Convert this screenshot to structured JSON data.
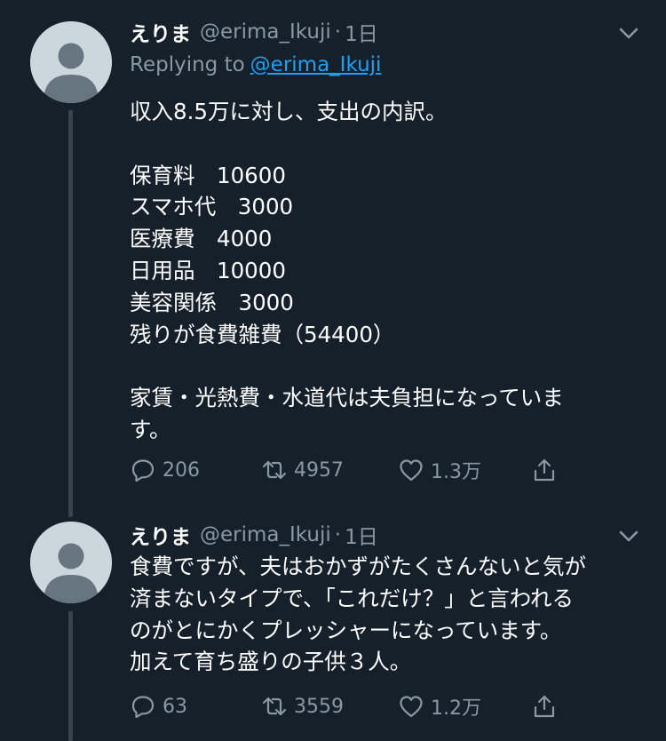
{
  "tweets": [
    {
      "display_name": "えりま",
      "handle": "@erima_Ikuji",
      "dot": "·",
      "time": "1日",
      "replying_label": "Replying to",
      "replying_mention": "@erima_Ikuji",
      "lines": [
        "収入8.5万に対し、支出の内訳。",
        "",
        "保育料　10600",
        "スマホ代　3000",
        "医療費　4000",
        "日用品　10000",
        "美容関係　3000",
        "残りが食費雑費（54400）",
        "",
        "家賃・光熱費・水道代は夫負担になっていま",
        "す。"
      ],
      "reply_count": "206",
      "retweet_count": "4957",
      "like_count": "1.3万"
    },
    {
      "display_name": "えりま",
      "handle": "@erima_Ikuji",
      "dot": "·",
      "time": "1日",
      "lines": [
        "食費ですが、夫はおかずがたくさんないと気が",
        "済まないタイプで、「これだけ？」と言われる",
        "のがとにかくプレッシャーになっています。",
        "加えて育ち盛りの子供３人。"
      ],
      "reply_count": "63",
      "retweet_count": "3559",
      "like_count": "1.2万"
    }
  ],
  "icons": {
    "avatar": "default-avatar-icon",
    "more": "chevron-down-icon",
    "reply": "reply-icon",
    "retweet": "retweet-icon",
    "like": "heart-icon",
    "share": "share-icon"
  },
  "colors": {
    "background": "#15202b",
    "text": "#ffffff",
    "secondary_text": "#8899a6",
    "link": "#1da1f2",
    "thread_line": "#38444d",
    "avatar": "#ccd6dd"
  }
}
